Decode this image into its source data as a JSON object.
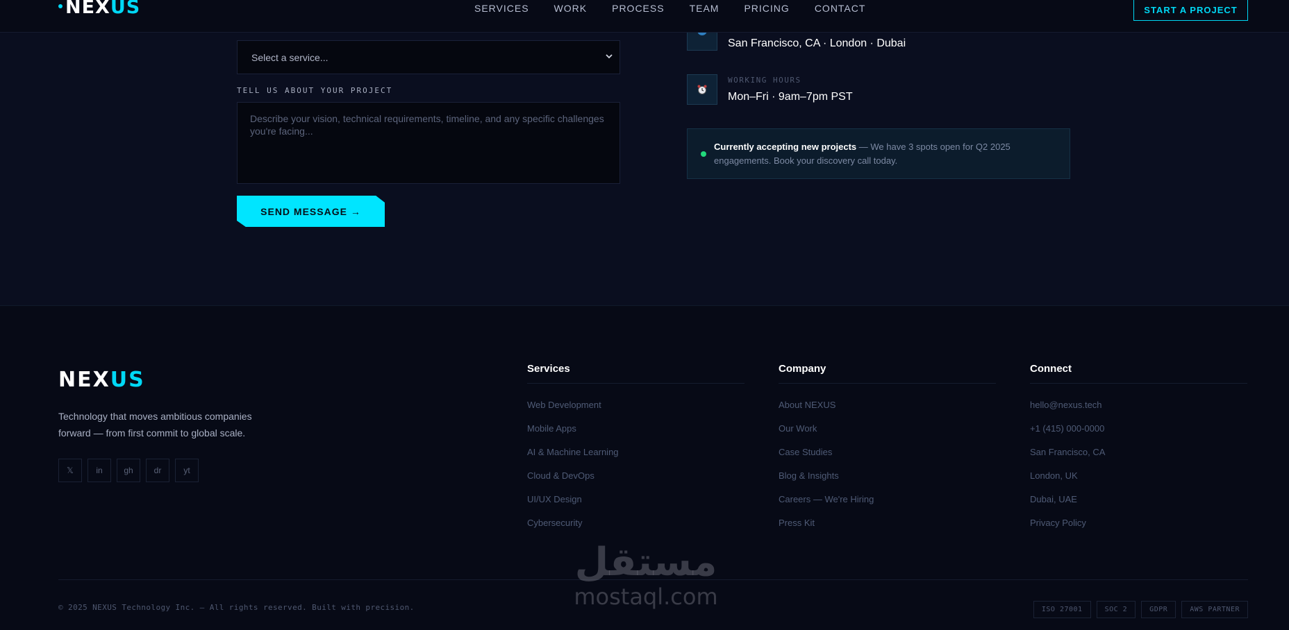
{
  "nav": {
    "logo_white": "NEX",
    "logo_cyan": "US",
    "links": [
      "SERVICES",
      "WORK",
      "PROCESS",
      "TEAM",
      "PRICING",
      "CONTACT"
    ],
    "cta": "START A PROJECT"
  },
  "form": {
    "service_select": "Select a service...",
    "project_label": "TELL US ABOUT YOUR PROJECT",
    "project_placeholder": "Describe your vision, technical requirements, timeline, and any specific challenges you're facing...",
    "send_button": "SEND MESSAGE →"
  },
  "contact_info": {
    "locations": "San Francisco, CA · London · Dubai",
    "hours_label": "WORKING HOURS",
    "hours_value": "Mon–Fri · 9am–7pm PST",
    "accepting_bold": "Currently accepting new projects",
    "accepting_rest": " — We have 3 spots open for Q2 2025 engagements. Book your discovery call today."
  },
  "footer": {
    "logo_white": "NEX",
    "logo_cyan": "US",
    "tagline": "Technology that moves ambitious companies forward — from first commit to global scale.",
    "socials": [
      "𝕏",
      "in",
      "gh",
      "dr",
      "yt"
    ],
    "columns": [
      {
        "title": "Services",
        "links": [
          "Web Development",
          "Mobile Apps",
          "AI & Machine Learning",
          "Cloud & DevOps",
          "UI/UX Design",
          "Cybersecurity"
        ]
      },
      {
        "title": "Company",
        "links": [
          "About NEXUS",
          "Our Work",
          "Case Studies",
          "Blog & Insights",
          "Careers — We're Hiring",
          "Press Kit"
        ]
      },
      {
        "title": "Connect",
        "links": [
          "hello@nexus.tech",
          "+1 (415) 000-0000",
          "San Francisco, CA",
          "London, UK",
          "Dubai, UAE",
          "Privacy Policy"
        ]
      }
    ],
    "copyright": "© 2025 NEXUS Technology Inc. — All rights reserved. Built with precision.",
    "badges": [
      "ISO 27001",
      "SOC 2",
      "GDPR",
      "AWS PARTNER"
    ]
  },
  "watermark": {
    "arabic": "مستقل",
    "latin": "mostaql.com"
  },
  "colors": {
    "accent": "#00e5ff",
    "background": "#0a0e1f",
    "footer_bg": "#070a16",
    "status_green": "#22d97c"
  }
}
